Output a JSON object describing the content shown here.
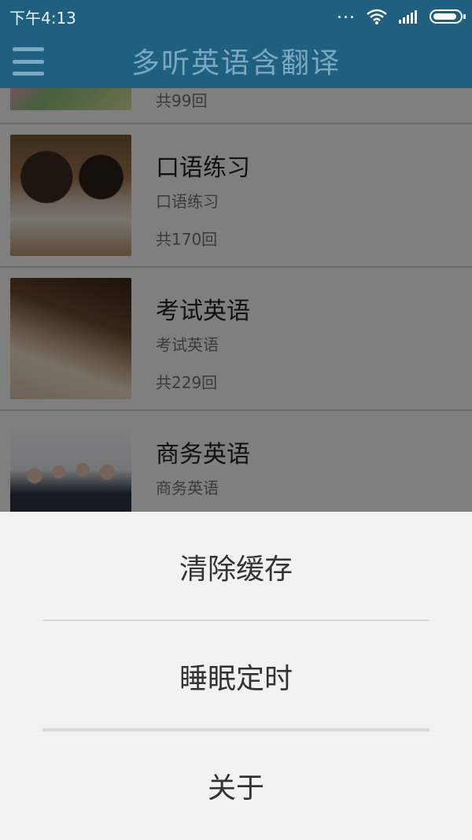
{
  "status_bar": {
    "time": "下午4:13",
    "more_dots": "...",
    "wifi_icon": "wifi-icon",
    "signal_icon": "signal-icon",
    "battery_icon": "battery-icon"
  },
  "app_bar": {
    "title": "多听英语含翻译",
    "menu_icon": "hamburger-menu-icon",
    "color": "#1f5f80"
  },
  "list": {
    "items": [
      {
        "name": "",
        "sub": "",
        "count": "共99回",
        "thumb": "study-photo"
      },
      {
        "name": "口语练习",
        "sub": "口语练习",
        "count": "共170回",
        "thumb": "conversation-photo"
      },
      {
        "name": "考试英语",
        "sub": "考试英语",
        "count": "共229回",
        "thumb": "writing-photo"
      },
      {
        "name": "商务英语",
        "sub": "商务英语",
        "count": "",
        "thumb": "business-team-photo"
      }
    ]
  },
  "sheet": {
    "options": [
      {
        "label": "清除缓存"
      },
      {
        "label": "睡眠定时"
      },
      {
        "label": "关于"
      }
    ]
  }
}
